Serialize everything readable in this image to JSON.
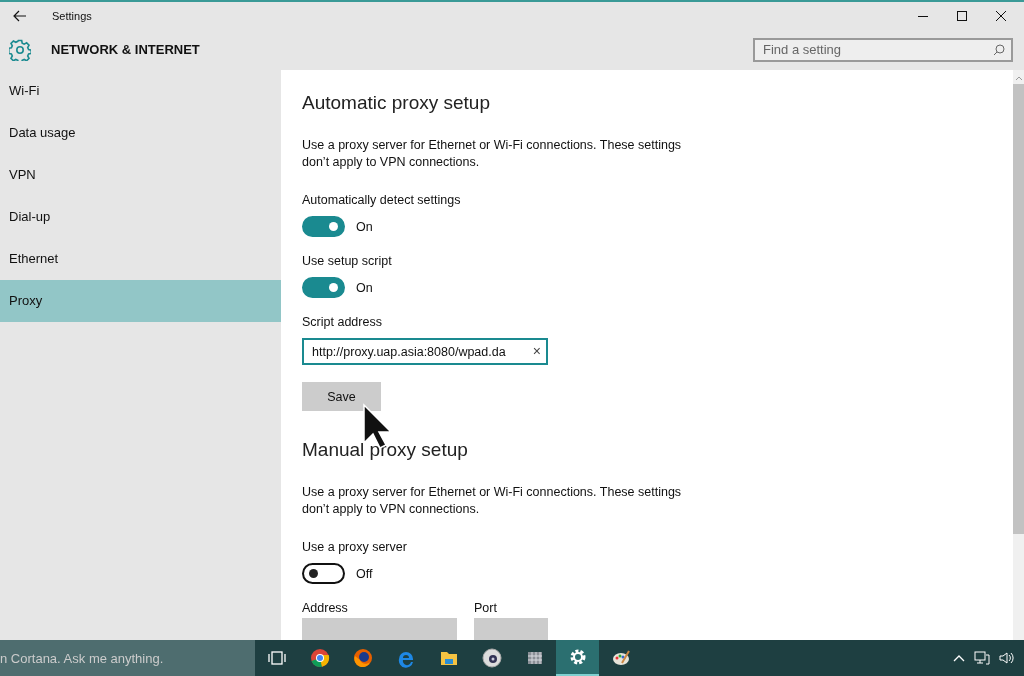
{
  "window": {
    "title": "Settings"
  },
  "header": {
    "title": "NETWORK & INTERNET",
    "search": {
      "placeholder": "Find a setting"
    }
  },
  "sidebar": {
    "items": [
      {
        "label": "Wi-Fi",
        "selected": false
      },
      {
        "label": "Data usage",
        "selected": false
      },
      {
        "label": "VPN",
        "selected": false
      },
      {
        "label": "Dial-up",
        "selected": false
      },
      {
        "label": "Ethernet",
        "selected": false
      },
      {
        "label": "Proxy",
        "selected": true
      }
    ]
  },
  "sections": [
    {
      "title": "Automatic proxy setup",
      "description": "Use a proxy server for Ethernet or Wi-Fi connections. These settings don’t apply to VPN connections.",
      "controls": [
        {
          "kind": "toggle",
          "label": "Automatically detect settings",
          "on": true,
          "state_text": "On"
        },
        {
          "kind": "toggle",
          "label": "Use setup script",
          "on": true,
          "state_text": "On"
        },
        {
          "kind": "field",
          "label": "Script address",
          "value": "http://proxy.uap.asia:8080/wpad.da",
          "clear": "×"
        },
        {
          "kind": "button",
          "label": "Save"
        }
      ]
    },
    {
      "title": "Manual proxy setup",
      "description": "Use a proxy server for Ethernet or Wi-Fi connections. These settings don’t apply to VPN connections.",
      "controls": [
        {
          "kind": "toggle",
          "label": "Use a proxy server",
          "on": false,
          "state_text": "Off"
        },
        {
          "kind": "fieldpair",
          "fields": [
            {
              "label": "Address"
            },
            {
              "label": "Port"
            }
          ]
        }
      ]
    }
  ],
  "taskbar": {
    "search": {
      "placeholder": "n Cortana. Ask me anything."
    },
    "apps": [
      {
        "kind": "taskview",
        "selected": false
      },
      {
        "kind": "chrome",
        "selected": false
      },
      {
        "kind": "firefox",
        "selected": false
      },
      {
        "kind": "edge",
        "selected": false
      },
      {
        "kind": "folder",
        "selected": false
      },
      {
        "kind": "disc",
        "selected": false
      },
      {
        "kind": "grid",
        "selected": false
      },
      {
        "kind": "settings",
        "selected": true
      },
      {
        "kind": "paint",
        "selected": false
      }
    ]
  }
}
